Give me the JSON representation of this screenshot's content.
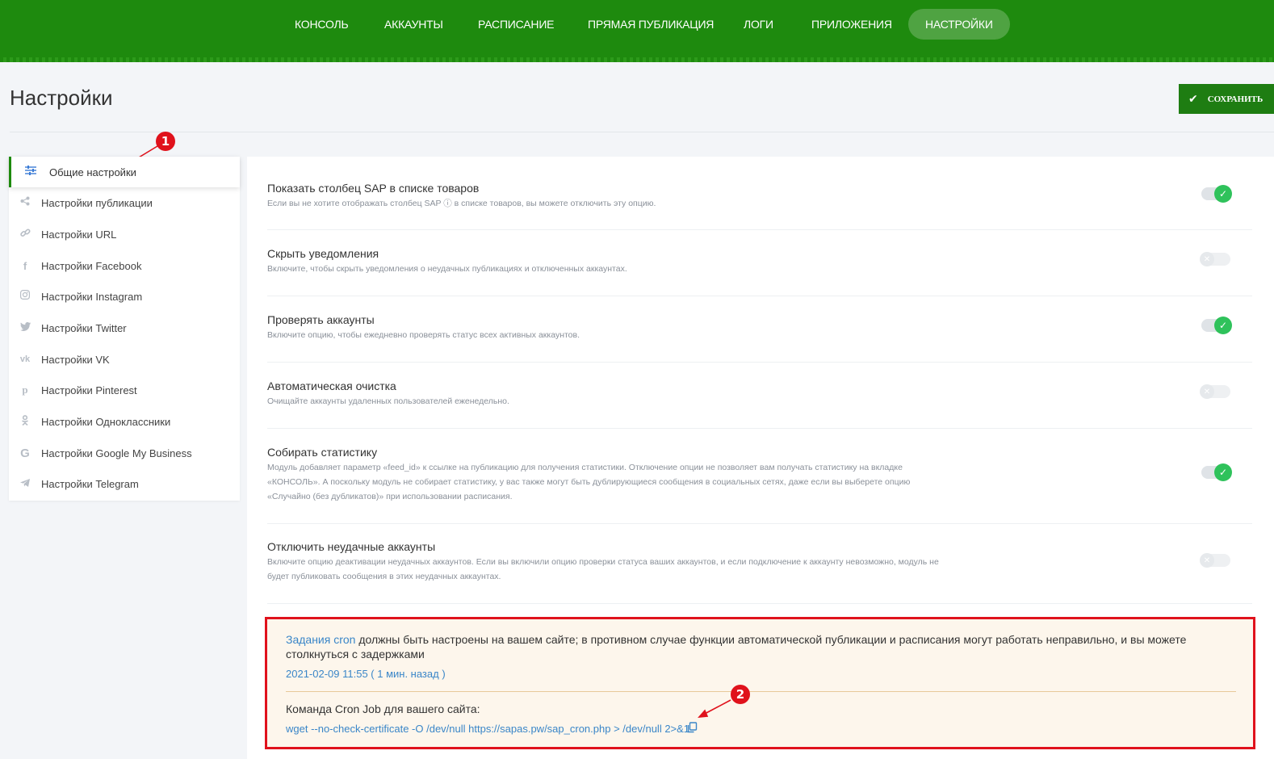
{
  "nav": {
    "items": [
      {
        "label": "КОНСОЛЬ"
      },
      {
        "label": "АККАУНТЫ"
      },
      {
        "label": "РАСПИСАНИЕ"
      },
      {
        "label": "ПРЯМАЯ ПУБЛИКАЦИЯ"
      },
      {
        "label": "ЛОГИ"
      },
      {
        "label": "ПРИЛОЖЕНИЯ"
      },
      {
        "label": "НАСТРОЙКИ",
        "active": true
      }
    ]
  },
  "header": {
    "title": "Настройки",
    "save_label": "СОХРАНИТЬ"
  },
  "sidebar": {
    "items": [
      {
        "label": "Общие настройки",
        "icon": "sliders-icon",
        "active": true
      },
      {
        "label": "Настройки публикации",
        "icon": "share-icon"
      },
      {
        "label": "Настройки URL",
        "icon": "link-icon"
      },
      {
        "label": "Настройки Facebook",
        "icon": "facebook-icon"
      },
      {
        "label": "Настройки Instagram",
        "icon": "instagram-icon"
      },
      {
        "label": "Настройки Twitter",
        "icon": "twitter-icon"
      },
      {
        "label": "Настройки VK",
        "icon": "vk-icon"
      },
      {
        "label": "Настройки Pinterest",
        "icon": "pinterest-icon"
      },
      {
        "label": "Настройки Одноклассники",
        "icon": "odnoklassniki-icon"
      },
      {
        "label": "Настройки Google My Business",
        "icon": "google-icon"
      },
      {
        "label": "Настройки Telegram",
        "icon": "telegram-icon"
      }
    ]
  },
  "settings": [
    {
      "title": "Показать столбец SAP в списке товаров",
      "desc": [
        "Если вы не хотите отображать столбец SAP ⓘ в списке товаров, вы можете отключить эту опцию."
      ],
      "enabled": true
    },
    {
      "title": "Скрыть уведомления",
      "desc": [
        "Включите, чтобы скрыть уведомления о неудачных публикациях и отключенных аккаунтах."
      ],
      "enabled": false
    },
    {
      "title": "Проверять аккаунты",
      "desc": [
        "Включите опцию, чтобы ежедневно проверять статус всех активных аккаунтов."
      ],
      "enabled": true
    },
    {
      "title": "Автоматическая очистка",
      "desc": [
        "Очищайте аккаунты удаленных пользователей еженедельно."
      ],
      "enabled": false
    },
    {
      "title": "Собирать статистику",
      "desc": [
        "Модуль добавляет параметр «feed_id» к ссылке на публикацию для получения статистики. Отключение опции не позволяет вам получать статистику на вкладке",
        "«КОНСОЛЬ». А поскольку модуль не собирает статистику, у вас также могут быть дублирующиеся сообщения в социальных сетях, даже если вы выберете опцию",
        "«Случайно (без дубликатов)» при использовании расписания."
      ],
      "enabled": true
    },
    {
      "title": "Отключить неудачные аккаунты",
      "desc": [
        "Включите опцию деактивации неудачных аккаунтов. Если вы включили опцию проверки статуса ваших аккаунтов, и если подключение к аккаунту невозможно, модуль не",
        "будет публиковать сообщения в этих неудачных аккаунтах."
      ],
      "enabled": false
    }
  ],
  "cron": {
    "link_text": "Задания cron",
    "message": " должны быть настроены на вашем сайте; в противном случае функции автоматической публикации и расписания могут работать неправильно, и вы можете столкнуться с задержками",
    "last_run": "2021-02-09 11:55 ( 1 мин. назад )",
    "command_label": "Команда Cron Job для вашего сайта:",
    "command": "wget --no-check-certificate -O /dev/null https://sapas.pw/sap_cron.php > /dev/null 2>&1"
  },
  "annotations": [
    {
      "number": "1"
    },
    {
      "number": "2"
    }
  ],
  "colors": {
    "brand": "#1e8a0e",
    "toggle_on": "#2fc25b",
    "link": "#3a86c8",
    "annotation": "#e0121c"
  }
}
